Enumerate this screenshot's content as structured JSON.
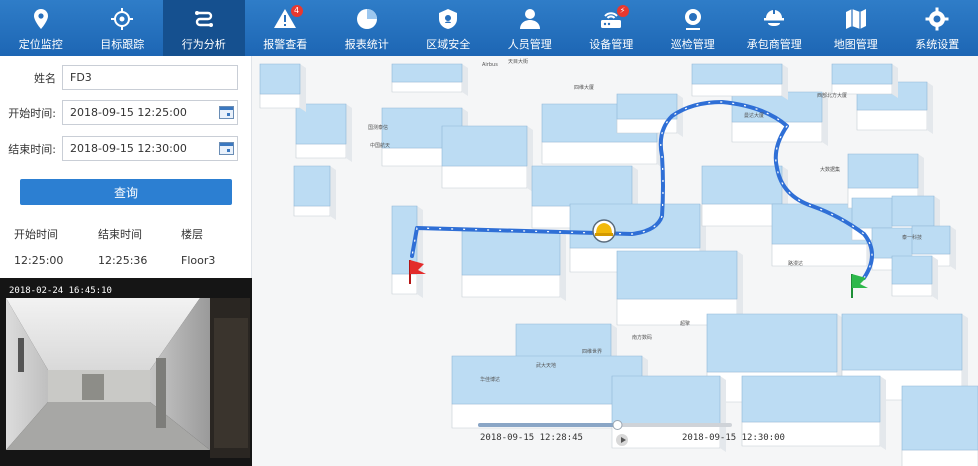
{
  "nav": {
    "items": [
      {
        "label": "定位监控",
        "icon": "location-pin-icon"
      },
      {
        "label": "目标跟踪",
        "icon": "crosshair-icon"
      },
      {
        "label": "行为分析",
        "icon": "route-icon",
        "active": true
      },
      {
        "label": "报警查看",
        "icon": "warning-icon",
        "badge": "4"
      },
      {
        "label": "报表统计",
        "icon": "pie-chart-icon"
      },
      {
        "label": "区域安全",
        "icon": "shield-icon"
      },
      {
        "label": "人员管理",
        "icon": "person-icon"
      },
      {
        "label": "设备管理",
        "icon": "router-icon",
        "badge": "⚡"
      },
      {
        "label": "巡检管理",
        "icon": "patrol-pin-icon"
      },
      {
        "label": "承包商管理",
        "icon": "worker-helmet-icon"
      },
      {
        "label": "地图管理",
        "icon": "folded-map-icon"
      },
      {
        "label": "系统设置",
        "icon": "gear-icon"
      }
    ]
  },
  "query": {
    "name_label": "姓名",
    "name_value": "FD3",
    "start_label": "开始时间:",
    "start_value": "2018-09-15 12:25:00",
    "end_label": "结束时间:",
    "end_value": "2018-09-15 12:30:00",
    "query_button": "查询"
  },
  "result_table": {
    "headers": [
      "开始时间",
      "结束时间",
      "楼层"
    ],
    "rows": [
      [
        "12:25:00",
        "12:25:36",
        "Floor3"
      ]
    ]
  },
  "camera": {
    "timestamp": "2018-02-24 16:45:10"
  },
  "map": {
    "labels": {
      "l1": "天目大街",
      "l2": "四维大厦",
      "l3": "西部北方大厦",
      "l4": "国测泰信",
      "l5": "中国航天",
      "l6": "曼达大厦",
      "l7": "大数据集",
      "l8": "泰一科技",
      "l9": "路漫达",
      "l10": "南方数码",
      "l11": "超擎",
      "l12": "四维世界",
      "l13": "武大天地",
      "l14": "华佳博达",
      "l15": "Airbus"
    },
    "colors": {
      "route": "#2f6fd6",
      "building_top": "#bcdcf3",
      "building_side": "#ffffff",
      "start_flag": "#2db84b",
      "end_flag": "#e32b2b"
    }
  },
  "timeline": {
    "current": "2018-09-15 12:28:45",
    "end": "2018-09-15 12:30:00",
    "progress": 0.55
  }
}
